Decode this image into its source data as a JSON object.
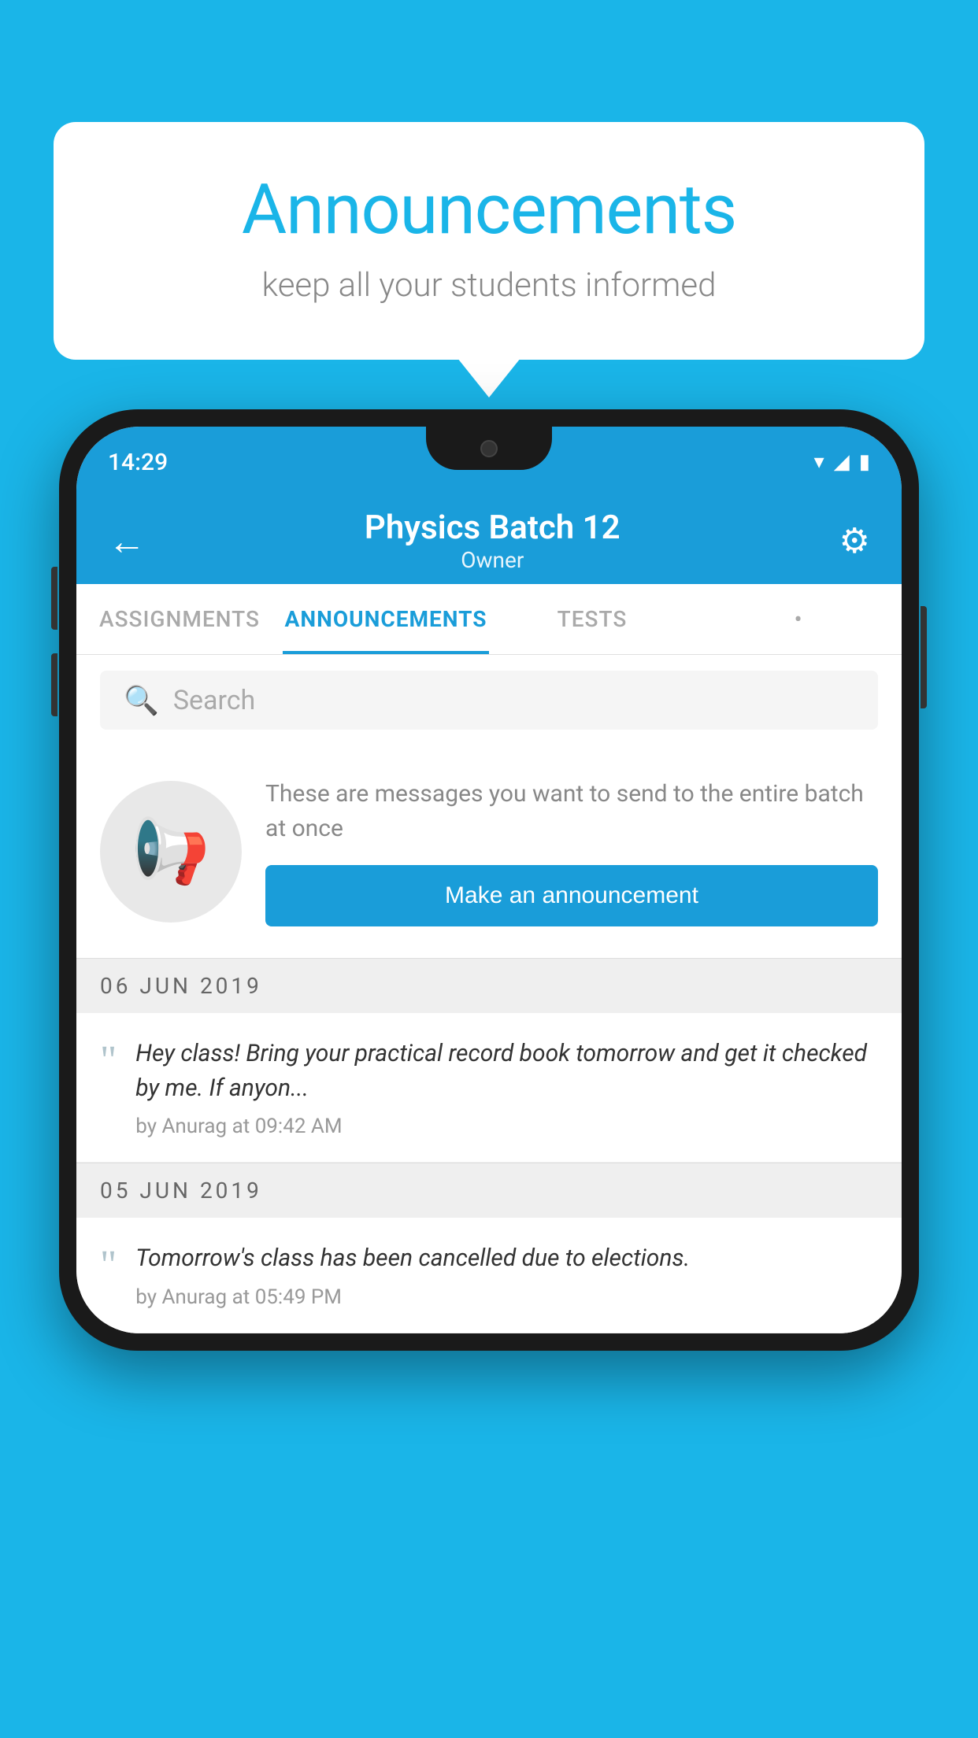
{
  "bubble": {
    "title": "Announcements",
    "subtitle": "keep all your students informed"
  },
  "phone": {
    "status": {
      "time": "14:29"
    },
    "appbar": {
      "title": "Physics Batch 12",
      "subtitle": "Owner",
      "back_label": "←"
    },
    "tabs": [
      {
        "label": "ASSIGNMENTS",
        "active": false
      },
      {
        "label": "ANNOUNCEMENTS",
        "active": true
      },
      {
        "label": "TESTS",
        "active": false
      },
      {
        "label": "•",
        "active": false
      }
    ],
    "search": {
      "placeholder": "Search"
    },
    "announcement_prompt": {
      "description": "These are messages you want to send to the entire batch at once",
      "button_label": "Make an announcement"
    },
    "dates": [
      {
        "date": "06  JUN  2019",
        "items": [
          {
            "text": "Hey class! Bring your practical record book tomorrow and get it checked by me. If anyon...",
            "meta": "by Anurag at 09:42 AM"
          }
        ]
      },
      {
        "date": "05  JUN  2019",
        "items": [
          {
            "text": "Tomorrow's class has been cancelled due to elections.",
            "meta": "by Anurag at 05:49 PM"
          }
        ]
      }
    ]
  }
}
